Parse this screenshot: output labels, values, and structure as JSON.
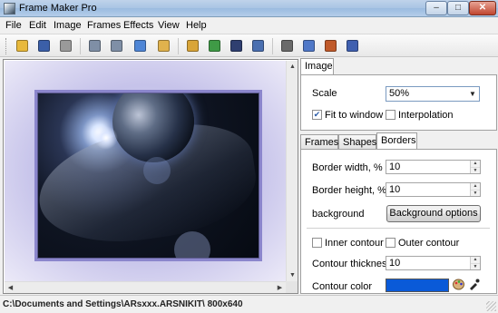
{
  "window": {
    "title": "Frame Maker Pro",
    "min_glyph": "–",
    "max_glyph": "□",
    "close_glyph": "✕"
  },
  "menu": [
    "File",
    "Edit",
    "Image",
    "Frames",
    "Effects",
    "View",
    "Help"
  ],
  "toolbar": {
    "buttons": [
      {
        "name": "open-icon",
        "color": "#e8b93b"
      },
      {
        "name": "save-icon",
        "color": "#3b5fa8"
      },
      {
        "name": "print-icon",
        "color": "#9a9a9a"
      },
      {
        "name": "undo-icon",
        "color": "#7f8fa6"
      },
      {
        "name": "redo-icon",
        "color": "#7f8fa6"
      },
      {
        "name": "copy-icon",
        "color": "#4f86d6"
      },
      {
        "name": "paste-icon",
        "color": "#e0b24d"
      },
      {
        "name": "frame-icon",
        "color": "#d9a538"
      },
      {
        "name": "image-icon",
        "color": "#3f9a46"
      },
      {
        "name": "border-icon",
        "color": "#2f3f70"
      },
      {
        "name": "pen-icon",
        "color": "#4a6fb0"
      },
      {
        "name": "crop-icon",
        "color": "#6a6a6a"
      },
      {
        "name": "effects-icon",
        "color": "#5078c8"
      },
      {
        "name": "text-icon",
        "color": "#c05a2a"
      },
      {
        "name": "document-icon",
        "color": "#4060b0"
      }
    ]
  },
  "status": {
    "text": "C:\\Documents and Settings\\ARsxxx.ARSNIKIT\\  800x640"
  },
  "image_panel": {
    "tab_label": "Image",
    "scale_label": "Scale",
    "scale_value": "50%",
    "fit_label": "Fit to window",
    "fit_checked": "✔",
    "interp_label": "Interpolation"
  },
  "tabs": [
    "Frames",
    "Shapes",
    "Borders"
  ],
  "borders": {
    "width_label": "Border width, %",
    "width_value": "10",
    "height_label": "Border height, %",
    "height_value": "10",
    "background_label": "background",
    "background_button": "Background options",
    "inner_label": "Inner contour",
    "outer_label": "Outer contour",
    "thickness_label": "Contour thickness",
    "thickness_value": "10",
    "color_label": "Contour color",
    "contour_color": "#0a5ad8"
  },
  "glyphs": {
    "dropdown": "▼",
    "up": "▲",
    "down": "▼",
    "left": "◀",
    "right": "▶"
  }
}
